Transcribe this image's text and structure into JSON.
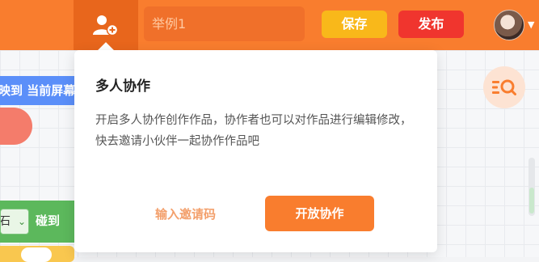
{
  "toolbar": {
    "title_placeholder": "举例1",
    "save_label": "保存",
    "publish_label": "发布"
  },
  "popover": {
    "title": "多人协作",
    "description": "开启多人协作创作作品，协作者也可以对作品进行编辑修改，快去邀请小伙伴一起协作作品吧",
    "invite_code_label": "输入邀请码",
    "open_collab_label": "开放协作"
  },
  "workspace": {
    "blue_block_text": "映到 当前屏幕",
    "green_block_slot_text": "石",
    "green_block_text": "碰到"
  },
  "colors": {
    "brand_orange": "#f97d2e",
    "save_yellow": "#f9b81a",
    "publish_red": "#f0352e"
  }
}
